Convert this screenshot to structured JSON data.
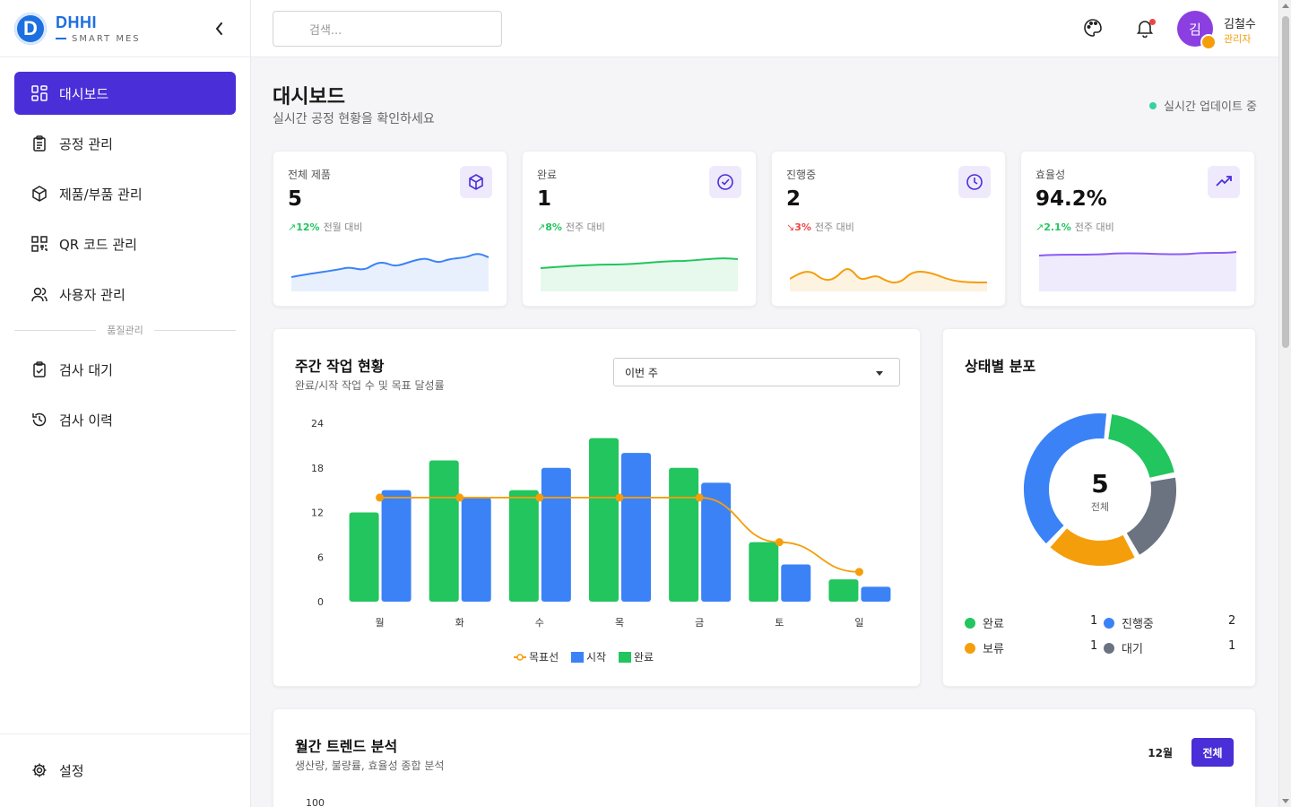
{
  "brand": {
    "logo_letter": "D",
    "name": "DHHI",
    "subtitle": "SMART MES"
  },
  "sidebar": {
    "items": [
      {
        "label": "대시보드",
        "icon": "dashboard-icon",
        "active": true
      },
      {
        "label": "공정 관리",
        "icon": "clipboard-icon"
      },
      {
        "label": "제품/부품 관리",
        "icon": "box-icon"
      },
      {
        "label": "QR 코드 관리",
        "icon": "qr-code-icon"
      },
      {
        "label": "사용자 관리",
        "icon": "users-icon"
      }
    ],
    "section_label": "품질관리",
    "quality_items": [
      {
        "label": "검사 대기",
        "icon": "clipboard-check-icon"
      },
      {
        "label": "검사 이력",
        "icon": "history-icon"
      }
    ],
    "settings_label": "설정"
  },
  "header": {
    "search_placeholder": "검색...",
    "user": {
      "avatar_text": "김",
      "name": "김철수",
      "role": "관리자"
    }
  },
  "page": {
    "title": "대시보드",
    "subtitle": "실시간 공정 현황을 확인하세요",
    "live_status": "실시간 업데이트 중"
  },
  "stats": [
    {
      "label": "전체 제품",
      "value": "5",
      "change": "12%",
      "period": "전월 대비",
      "trend": "up",
      "icon": "box-icon"
    },
    {
      "label": "완료",
      "value": "1",
      "change": "8%",
      "period": "전주 대비",
      "trend": "up",
      "icon": "check-circle-icon"
    },
    {
      "label": "진행중",
      "value": "2",
      "change": "3%",
      "period": "전주 대비",
      "trend": "down",
      "icon": "clock-icon"
    },
    {
      "label": "효율성",
      "value": "94.2%",
      "change": "2.1%",
      "period": "전주 대비",
      "trend": "up",
      "icon": "trending-up-icon"
    }
  ],
  "colors": {
    "primary": "#4a2fd8",
    "blue": "#3b82f6",
    "green": "#22c55e",
    "orange": "#f59e0b",
    "gray": "#6b7280"
  },
  "weekly": {
    "title": "주간 작업 현황",
    "subtitle": "완료/시작 작업 수 및 목표 달성률",
    "period_select": "이번 주",
    "chart_data": {
      "type": "bar",
      "categories": [
        "월",
        "화",
        "수",
        "목",
        "금",
        "토",
        "일"
      ],
      "series": [
        {
          "name": "완료",
          "type": "bar",
          "color": "#22c55e",
          "values": [
            12,
            19,
            15,
            22,
            18,
            8,
            3
          ]
        },
        {
          "name": "시작",
          "type": "bar",
          "color": "#3b82f6",
          "values": [
            15,
            14,
            18,
            20,
            16,
            5,
            2
          ]
        },
        {
          "name": "목표선",
          "type": "line",
          "color": "#f59e0b",
          "values": [
            14,
            14,
            14,
            14,
            14,
            8,
            4
          ]
        }
      ],
      "y_ticks": [
        0,
        6,
        12,
        18,
        24
      ],
      "ylim": [
        0,
        24
      ],
      "legend": [
        "목표선",
        "시작",
        "완료"
      ],
      "legend_position": "bottom"
    }
  },
  "status": {
    "title": "상태별 분포",
    "total_value": "5",
    "total_label": "전체",
    "chart_data": {
      "type": "pie",
      "slices": [
        {
          "name": "완료",
          "value": 1,
          "color": "#22c55e"
        },
        {
          "name": "대기",
          "value": 1,
          "color": "#6b7280"
        },
        {
          "name": "보류",
          "value": 1,
          "color": "#f59e0b"
        },
        {
          "name": "진행중",
          "value": 2,
          "color": "#3b82f6"
        }
      ]
    },
    "legend": [
      {
        "name": "완료",
        "value": "1",
        "color": "#22c55e"
      },
      {
        "name": "진행중",
        "value": "2",
        "color": "#3b82f6"
      },
      {
        "name": "보류",
        "value": "1",
        "color": "#f59e0b"
      },
      {
        "name": "대기",
        "value": "1",
        "color": "#6b7280"
      }
    ]
  },
  "monthly": {
    "title": "월간 트렌드 분석",
    "subtitle": "생산량, 불량률, 효율성 종합 분석",
    "month_label": "12월",
    "all_button": "전체",
    "y_top_tick": "100"
  }
}
